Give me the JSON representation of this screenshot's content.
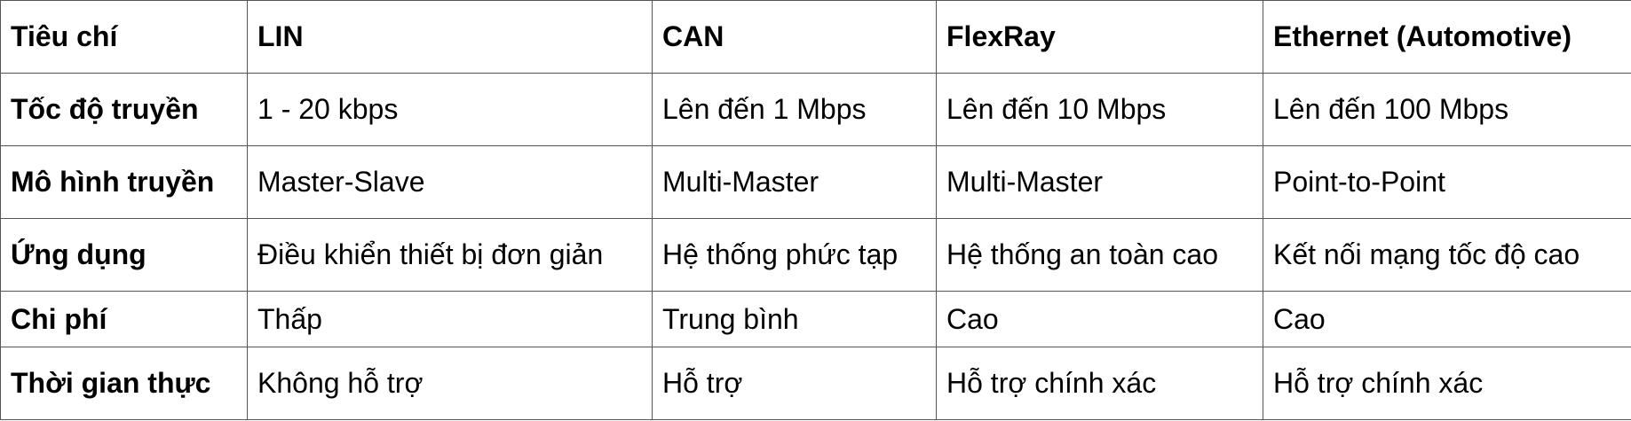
{
  "table": {
    "headers": [
      "Tiêu chí",
      "LIN",
      "CAN",
      "FlexRay",
      "Ethernet (Automotive)"
    ],
    "rows": [
      [
        "Tốc độ truyền",
        "1 - 20 kbps",
        "Lên đến 1 Mbps",
        "Lên đến 10 Mbps",
        "Lên đến 100 Mbps"
      ],
      [
        "Mô hình truyền",
        "Master-Slave",
        "Multi-Master",
        "Multi-Master",
        "Point-to-Point"
      ],
      [
        "Ứng dụng",
        "Điều khiển thiết bị đơn giản",
        "Hệ thống phức tạp",
        "Hệ thống an toàn cao",
        "Kết nối mạng tốc độ cao"
      ],
      [
        "Chi phí",
        "Thấp",
        "Trung bình",
        "Cao",
        "Cao"
      ],
      [
        "Thời gian thực",
        "Không hỗ trợ",
        "Hỗ trợ",
        "Hỗ trợ chính xác",
        "Hỗ trợ chính xác"
      ]
    ]
  },
  "colors": {
    "border": "#555555",
    "text": "#000000",
    "background": "#ffffff"
  }
}
